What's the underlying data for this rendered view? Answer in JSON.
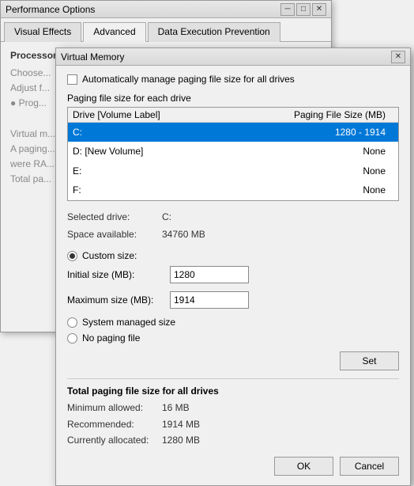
{
  "perf_window": {
    "title": "Performance Options",
    "close_btn": "✕",
    "min_btn": "─",
    "max_btn": "□",
    "tabs": [
      {
        "label": "Visual Effects",
        "active": false
      },
      {
        "label": "Advanced",
        "active": true
      },
      {
        "label": "Data Execution Prevention",
        "active": false
      }
    ],
    "content_title": "Processor scheduling",
    "content_text1": "Choose...",
    "content_text2": "Adjust f...",
    "content_text3": "● Prog...",
    "content_text4": "Virtual m...",
    "content_text5": "A paging...",
    "content_text6": "were RA...",
    "content_text7": "Total pa..."
  },
  "vm_dialog": {
    "title": "Virtual Memory",
    "close_btn": "✕",
    "checkbox_label": "Automatically manage paging file size for all drives",
    "checkbox_checked": false,
    "table_label": "Paging file size for each drive",
    "table_headers": {
      "drive": "Drive  [Volume Label]",
      "size": "Paging File Size (MB)"
    },
    "drives": [
      {
        "label": "C:",
        "volume": "",
        "size": "1280 - 1914",
        "selected": true
      },
      {
        "label": "D:",
        "volume": "    [New Volume]",
        "size": "None",
        "selected": false
      },
      {
        "label": "E:",
        "volume": "",
        "size": "None",
        "selected": false
      },
      {
        "label": "F:",
        "volume": "",
        "size": "None",
        "selected": false
      }
    ],
    "selected_drive_label": "Selected drive:",
    "selected_drive_value": "C:",
    "space_available_label": "Space available:",
    "space_available_value": "34760 MB",
    "custom_size_label": "Custom size:",
    "initial_size_label": "Initial size (MB):",
    "initial_size_value": "1280",
    "maximum_size_label": "Maximum size (MB):",
    "maximum_size_value": "1914",
    "system_managed_label": "System managed size",
    "no_paging_label": "No paging file",
    "set_btn": "Set",
    "total_title": "Total paging file size for all drives",
    "minimum_label": "Minimum allowed:",
    "minimum_value": "16 MB",
    "recommended_label": "Recommended:",
    "recommended_value": "1914 MB",
    "allocated_label": "Currently allocated:",
    "allocated_value": "1280 MB",
    "ok_btn": "OK",
    "cancel_btn": "Cancel"
  }
}
